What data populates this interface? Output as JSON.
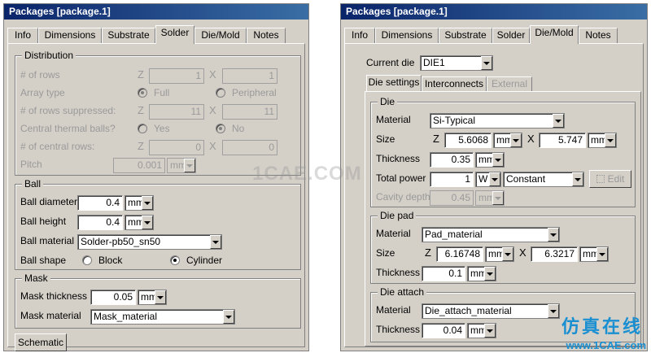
{
  "left": {
    "title": "Packages [package.1]",
    "tabs": [
      "Info",
      "Dimensions",
      "Substrate",
      "Solder",
      "Die/Mold",
      "Notes"
    ],
    "active_tab": "Solder",
    "distribution": {
      "title": "Distribution",
      "rows_label": "# of rows",
      "rows_z": "1",
      "rows_x": "1",
      "array_label": "Array type",
      "array_full": "Full",
      "array_peripheral": "Peripheral",
      "supp_label": "# of rows suppressed:",
      "supp_z": "11",
      "supp_x": "11",
      "thermal_label": "Central thermal balls?",
      "thermal_yes": "Yes",
      "thermal_no": "No",
      "central_label": "# of central rows:",
      "central_z": "0",
      "central_x": "0",
      "pitch_label": "Pitch",
      "pitch_value": "0.001",
      "pitch_unit": "mm"
    },
    "ball": {
      "title": "Ball",
      "diameter_label": "Ball diameter",
      "diameter_value": "0.4",
      "diameter_unit": "mm",
      "height_label": "Ball height",
      "height_value": "0.4",
      "height_unit": "mm",
      "material_label": "Ball material",
      "material_value": "Solder-pb50_sn50",
      "shape_label": "Ball shape",
      "shape_block": "Block",
      "shape_cylinder": "Cylinder"
    },
    "mask": {
      "title": "Mask",
      "thickness_label": "Mask thickness",
      "thickness_value": "0.05",
      "thickness_unit": "mm",
      "material_label": "Mask material",
      "material_value": "Mask_material"
    },
    "schematic_button": "Schematic",
    "z_tag": "Z",
    "x_tag": "X"
  },
  "right": {
    "title": "Packages [package.1]",
    "tabs": [
      "Info",
      "Dimensions",
      "Substrate",
      "Solder",
      "Die/Mold",
      "Notes"
    ],
    "active_tab": "Die/Mold",
    "current_die_label": "Current die",
    "current_die_value": "DIE1",
    "subtabs": [
      "Die settings",
      "Interconnects",
      "External"
    ],
    "die": {
      "title": "Die",
      "material_label": "Material",
      "material_value": "Si-Typical",
      "size_label": "Size",
      "size_z": "5.6068",
      "size_x": "5.747",
      "size_unit": "mm",
      "thickness_label": "Thickness",
      "thickness_value": "0.35",
      "thickness_unit": "mm",
      "power_label": "Total power",
      "power_value": "1",
      "power_unit": "W",
      "power_mode": "Constant",
      "edit_button": "Edit",
      "cavity_label": "Cavity depth",
      "cavity_value": "0.45",
      "cavity_unit": "mm"
    },
    "pad": {
      "title": "Die pad",
      "material_label": "Material",
      "material_value": "Pad_material",
      "size_label": "Size",
      "size_z": "6.16748",
      "size_x": "6.3217",
      "size_unit": "mm",
      "thickness_label": "Thickness",
      "thickness_value": "0.1",
      "thickness_unit": "mm"
    },
    "attach": {
      "title": "Die attach",
      "material_label": "Material",
      "material_value": "Die_attach_material",
      "thickness_label": "Thickness",
      "thickness_value": "0.04",
      "thickness_unit": "mm"
    },
    "z_tag": "Z",
    "x_tag": "X"
  },
  "watermark": "1CAE.COM",
  "logo": {
    "chinese": "仿真在线",
    "url": "www.1CAE.com"
  },
  "colors": {
    "titlebar": "#0a246a",
    "panel": "#d4d0c8",
    "logo": "#1a8fd1"
  }
}
